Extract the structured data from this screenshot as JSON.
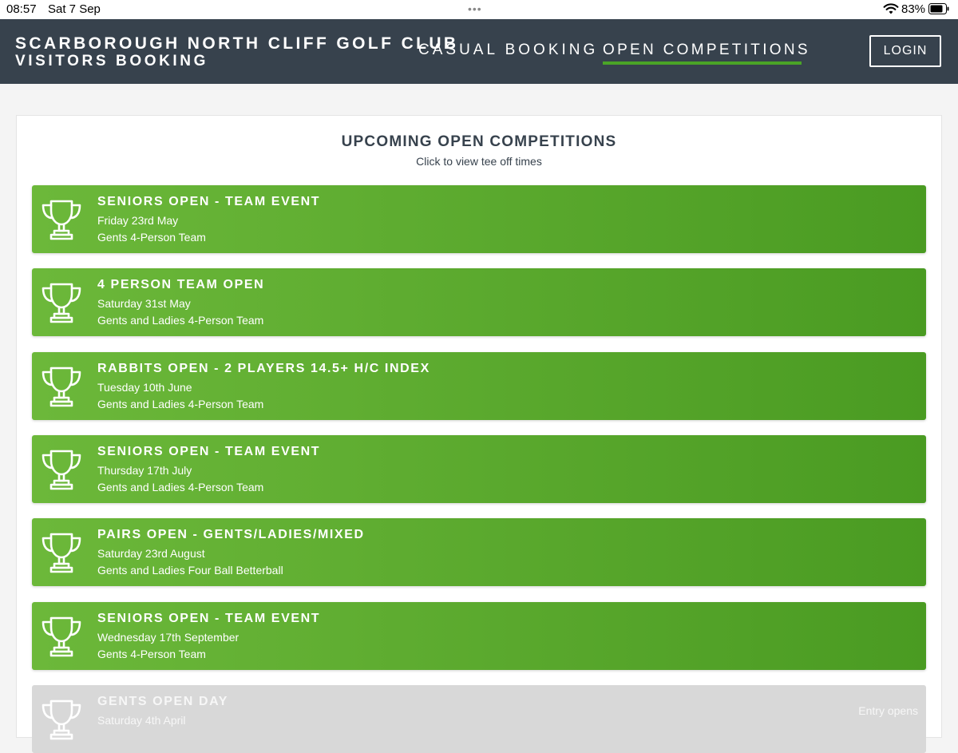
{
  "statusbar": {
    "time": "08:57",
    "date": "Sat 7 Sep",
    "dots": "•••",
    "battery": "83%"
  },
  "header": {
    "brand_line1": "SCARBOROUGH NORTH CLIFF GOLF CLUB",
    "brand_line2": "VISITORS BOOKING",
    "nav": {
      "casual": "CASUAL BOOKING",
      "open": "OPEN COMPETITIONS"
    },
    "login": "LOGIN",
    "colors": {
      "bar": "#37424d",
      "accent": "#4aa427"
    }
  },
  "main": {
    "heading": "UPCOMING OPEN COMPETITIONS",
    "subheading": "Click to view tee off times",
    "competitions": [
      {
        "title": "SENIORS OPEN - TEAM EVENT",
        "date": "Friday 23rd May",
        "format": "Gents 4-Person Team",
        "icon": "trophy-icon"
      },
      {
        "title": "4 PERSON TEAM OPEN",
        "date": "Saturday 31st May",
        "format": "Gents and Ladies 4-Person Team",
        "icon": "trophy-icon"
      },
      {
        "title": "RABBITS OPEN - 2 PLAYERS 14.5+ H/C INDEX",
        "date": "Tuesday 10th June",
        "format": "Gents and Ladies 4-Person Team",
        "icon": "trophy-icon"
      },
      {
        "title": "SENIORS OPEN - TEAM EVENT",
        "date": "Thursday 17th July",
        "format": "Gents and Ladies 4-Person Team",
        "icon": "trophy-icon"
      },
      {
        "title": "PAIRS OPEN - GENTS/LADIES/MIXED",
        "date": "Saturday 23rd August",
        "format": "Gents and Ladies Four Ball Betterball",
        "icon": "trophy-icon"
      },
      {
        "title": "SENIORS OPEN - TEAM EVENT",
        "date": "Wednesday 17th September",
        "format": "Gents 4-Person Team",
        "icon": "trophy-icon"
      },
      {
        "title": "GENTS OPEN DAY",
        "date": "Saturday 4th April",
        "format": "",
        "entry_note": "Entry opens",
        "icon": "trophy-icon"
      }
    ],
    "colors": {
      "active_start": "#6cb83a",
      "active_end": "#4a9b22",
      "disabled": "#d8d8d8"
    }
  }
}
